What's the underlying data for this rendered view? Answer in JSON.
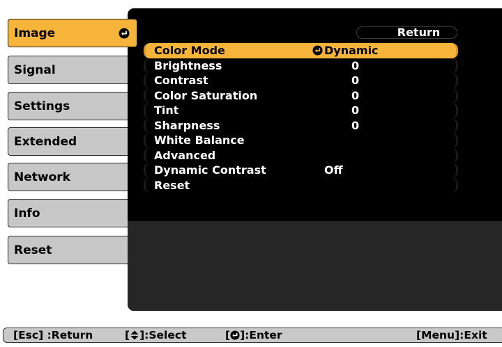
{
  "sidebar": {
    "items": [
      {
        "label": "Image",
        "selected": true
      },
      {
        "label": "Signal"
      },
      {
        "label": "Settings"
      },
      {
        "label": "Extended"
      },
      {
        "label": "Network"
      },
      {
        "label": "Info"
      },
      {
        "label": "Reset"
      }
    ]
  },
  "main": {
    "return_label": "Return",
    "rows": [
      {
        "label": "Color Mode",
        "value": "Dynamic",
        "selected": true
      },
      {
        "label": "Brightness",
        "value": "0"
      },
      {
        "label": "Contrast",
        "value": "0"
      },
      {
        "label": "Color Saturation",
        "value": "0"
      },
      {
        "label": "Tint",
        "value": "0"
      },
      {
        "label": "Sharpness",
        "value": "0"
      },
      {
        "label": "White Balance",
        "value": ""
      },
      {
        "label": "Advanced",
        "value": ""
      },
      {
        "label": "Dynamic Contrast",
        "value": "Off"
      },
      {
        "label": "Reset",
        "value": ""
      }
    ]
  },
  "help_bar": {
    "esc_text": "[Esc] :Return",
    "select_prefix": "[",
    "select_suffix": "]:Select",
    "enter_prefix": "[",
    "enter_suffix": "]:Enter",
    "menu_text": "[Menu]:Exit"
  },
  "colors": {
    "accent": "#f6b43a",
    "tab_bg": "#c7c7c7",
    "panel_bg": "#000000",
    "help_bg": "#c9c9c9"
  },
  "icons": {
    "enter": "enter-return-icon",
    "updown": "up-down-arrows-icon"
  }
}
